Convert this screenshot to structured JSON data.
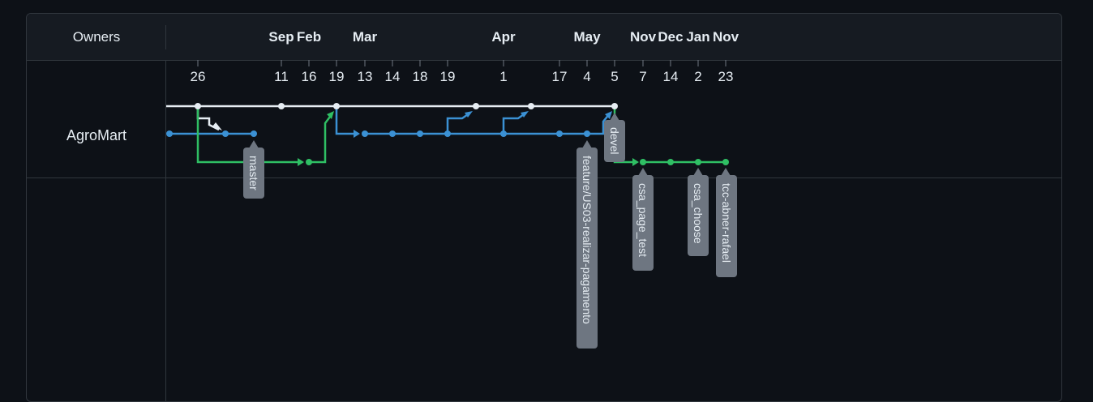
{
  "header": {
    "owners_label": "Owners"
  },
  "repo": {
    "name": "AgroMart"
  },
  "timeline": {
    "months": [
      "Sep",
      "Feb",
      "Mar",
      "Apr",
      "May",
      "Nov",
      "Dec",
      "Jan",
      "Nov"
    ],
    "days": [
      "26",
      "11",
      "16",
      "19",
      "13",
      "14",
      "18",
      "19",
      "1",
      "17",
      "4",
      "5",
      "7",
      "14",
      "2",
      "23"
    ]
  },
  "branches": [
    {
      "name": "master",
      "color": "#e6edf3"
    },
    {
      "name": "devel",
      "color": "#3b91d4"
    },
    {
      "name": "feature/US03-realizar-pagamento",
      "color": "#3b91d4"
    },
    {
      "name": "csa_page_test",
      "color": "#2fbf64"
    },
    {
      "name": "csa_choose",
      "color": "#2fbf64"
    },
    {
      "name": "tcc-abner-rafael",
      "color": "#2fbf64"
    }
  ],
  "colors": {
    "background": "#0d1117",
    "header": "#161b22",
    "border": "#30363d",
    "main_line": "#e6edf3",
    "blue_line": "#3b91d4",
    "green_line": "#2fbf64",
    "tag_bg": "#6e7681"
  }
}
